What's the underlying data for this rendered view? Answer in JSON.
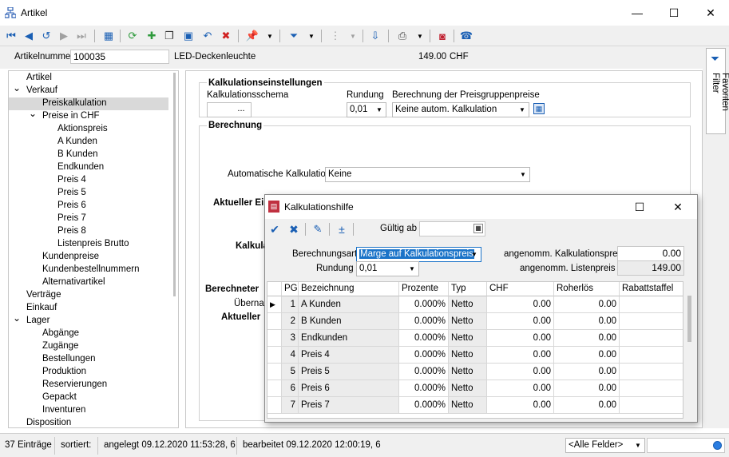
{
  "window": {
    "title": "Artikel",
    "min": "—",
    "max": "☐",
    "close": "✕"
  },
  "toolbar": {
    "icons": [
      "first-record-icon",
      "prev-record-icon",
      "refresh-back-icon",
      "next-record-icon",
      "last-record-icon",
      "table-view-icon",
      "refresh-icon",
      "new-record-icon",
      "copy-record-icon",
      "save-icon",
      "undo-icon",
      "delete-icon",
      "pin-icon",
      "filter-icon",
      "tree-icon",
      "export-icon",
      "print-icon",
      "report-icon",
      "phone-icon"
    ]
  },
  "header": {
    "artikelnummer_label": "Artikelnummer",
    "artikelnummer_value": "100035",
    "description": "LED-Deckenleuchte",
    "price": "149.00",
    "currency": "CHF"
  },
  "tree": {
    "items": [
      {
        "label": "Artikel",
        "level": 0,
        "expander": ""
      },
      {
        "label": "Verkauf",
        "level": 0,
        "expander": "⌄"
      },
      {
        "label": "Preiskalkulation",
        "level": 1,
        "expander": "",
        "selected": true
      },
      {
        "label": "Preise in CHF",
        "level": 1,
        "expander": "⌄"
      },
      {
        "label": "Aktionspreis",
        "level": 2,
        "expander": ""
      },
      {
        "label": "A Kunden",
        "level": 2,
        "expander": ""
      },
      {
        "label": "B Kunden",
        "level": 2,
        "expander": ""
      },
      {
        "label": "Endkunden",
        "level": 2,
        "expander": ""
      },
      {
        "label": "Preis 4",
        "level": 2,
        "expander": ""
      },
      {
        "label": "Preis 5",
        "level": 2,
        "expander": ""
      },
      {
        "label": "Preis 6",
        "level": 2,
        "expander": ""
      },
      {
        "label": "Preis 7",
        "level": 2,
        "expander": ""
      },
      {
        "label": "Preis 8",
        "level": 2,
        "expander": ""
      },
      {
        "label": "Listenpreis Brutto",
        "level": 2,
        "expander": ""
      },
      {
        "label": "Kundenpreise",
        "level": 1,
        "expander": ""
      },
      {
        "label": "Kundenbestellnummern",
        "level": 1,
        "expander": ""
      },
      {
        "label": "Alternativartikel",
        "level": 1,
        "expander": ""
      },
      {
        "label": "Verträge",
        "level": 0,
        "expander": ""
      },
      {
        "label": "Einkauf",
        "level": 0,
        "expander": ""
      },
      {
        "label": "Lager",
        "level": 0,
        "expander": "⌄"
      },
      {
        "label": "Abgänge",
        "level": 1,
        "expander": ""
      },
      {
        "label": "Zugänge",
        "level": 1,
        "expander": ""
      },
      {
        "label": "Bestellungen",
        "level": 1,
        "expander": ""
      },
      {
        "label": "Produktion",
        "level": 1,
        "expander": ""
      },
      {
        "label": "Reservierungen",
        "level": 1,
        "expander": ""
      },
      {
        "label": "Gepackt",
        "level": 1,
        "expander": ""
      },
      {
        "label": "Inventuren",
        "level": 1,
        "expander": ""
      },
      {
        "label": "Disposition",
        "level": 0,
        "expander": ""
      }
    ]
  },
  "kalk": {
    "section_title": "Kalkulationseinstellungen",
    "schema_label": "Kalkulationsschema",
    "schema_button": "...",
    "rundung_label": "Rundung",
    "rundung_value": "0,01",
    "berechnung_label": "Berechnung der Preisgruppenpreise",
    "berechnung_value": "Keine autom. Kalkulation"
  },
  "berechnung": {
    "section_title": "Berechnung",
    "auto_label": "Automatische Kalkulation",
    "auto_value": "Keine",
    "aktueller_ein": "Aktueller Ei",
    "kalkulat": "Kalkulat",
    "berechneter": "Berechneter",
    "ubernahm": "Übernahm",
    "aktueller2": "Aktueller"
  },
  "sidepanel": {
    "filter_label": "Favoriten Filter"
  },
  "dialog": {
    "title": "Kalkulationshilfe",
    "max": "☐",
    "close": "✕",
    "gueltig_label": "Gültig ab",
    "gueltig_value": "",
    "berechnungsart_label": "Berechnungsart",
    "berechnungsart_value": "Marge auf Kalkulationspreis",
    "rundung_label": "Rundung",
    "rundung_value": "0,01",
    "kalkpreis_label": "angenomm. Kalkulationspreis",
    "kalkpreis_value": "0.00",
    "listenpreis_label": "angenomm. Listenpreis",
    "listenpreis_value": "149.00",
    "columns": [
      "PG",
      "Bezeichnung",
      "Prozente",
      "Typ",
      "CHF",
      "Roherlös",
      "Rabattstaffel"
    ],
    "rows": [
      {
        "pg": "1",
        "bez": "A Kunden",
        "proz": "0.000%",
        "typ": "Netto",
        "chf": "0.00",
        "roh": "0.00",
        "rab": "",
        "current": true
      },
      {
        "pg": "2",
        "bez": "B Kunden",
        "proz": "0.000%",
        "typ": "Netto",
        "chf": "0.00",
        "roh": "0.00",
        "rab": ""
      },
      {
        "pg": "3",
        "bez": "Endkunden",
        "proz": "0.000%",
        "typ": "Netto",
        "chf": "0.00",
        "roh": "0.00",
        "rab": ""
      },
      {
        "pg": "4",
        "bez": "Preis 4",
        "proz": "0.000%",
        "typ": "Netto",
        "chf": "0.00",
        "roh": "0.00",
        "rab": ""
      },
      {
        "pg": "5",
        "bez": "Preis 5",
        "proz": "0.000%",
        "typ": "Netto",
        "chf": "0.00",
        "roh": "0.00",
        "rab": ""
      },
      {
        "pg": "6",
        "bez": "Preis 6",
        "proz": "0.000%",
        "typ": "Netto",
        "chf": "0.00",
        "roh": "0.00",
        "rab": ""
      },
      {
        "pg": "7",
        "bez": "Preis 7",
        "proz": "0.000%",
        "typ": "Netto",
        "chf": "0.00",
        "roh": "0.00",
        "rab": ""
      }
    ]
  },
  "status": {
    "count": "37 Einträge",
    "sorted": "sortiert:",
    "created": "angelegt 09.12.2020 11:53:28,  6",
    "edited": "bearbeitet 09.12.2020 12:00:19,  6",
    "fields": "<Alle Felder>"
  },
  "colors": {
    "accent": "#1a73c8",
    "toolbar_bg": "#f0f0f0",
    "selected": "#d9d9d9"
  }
}
